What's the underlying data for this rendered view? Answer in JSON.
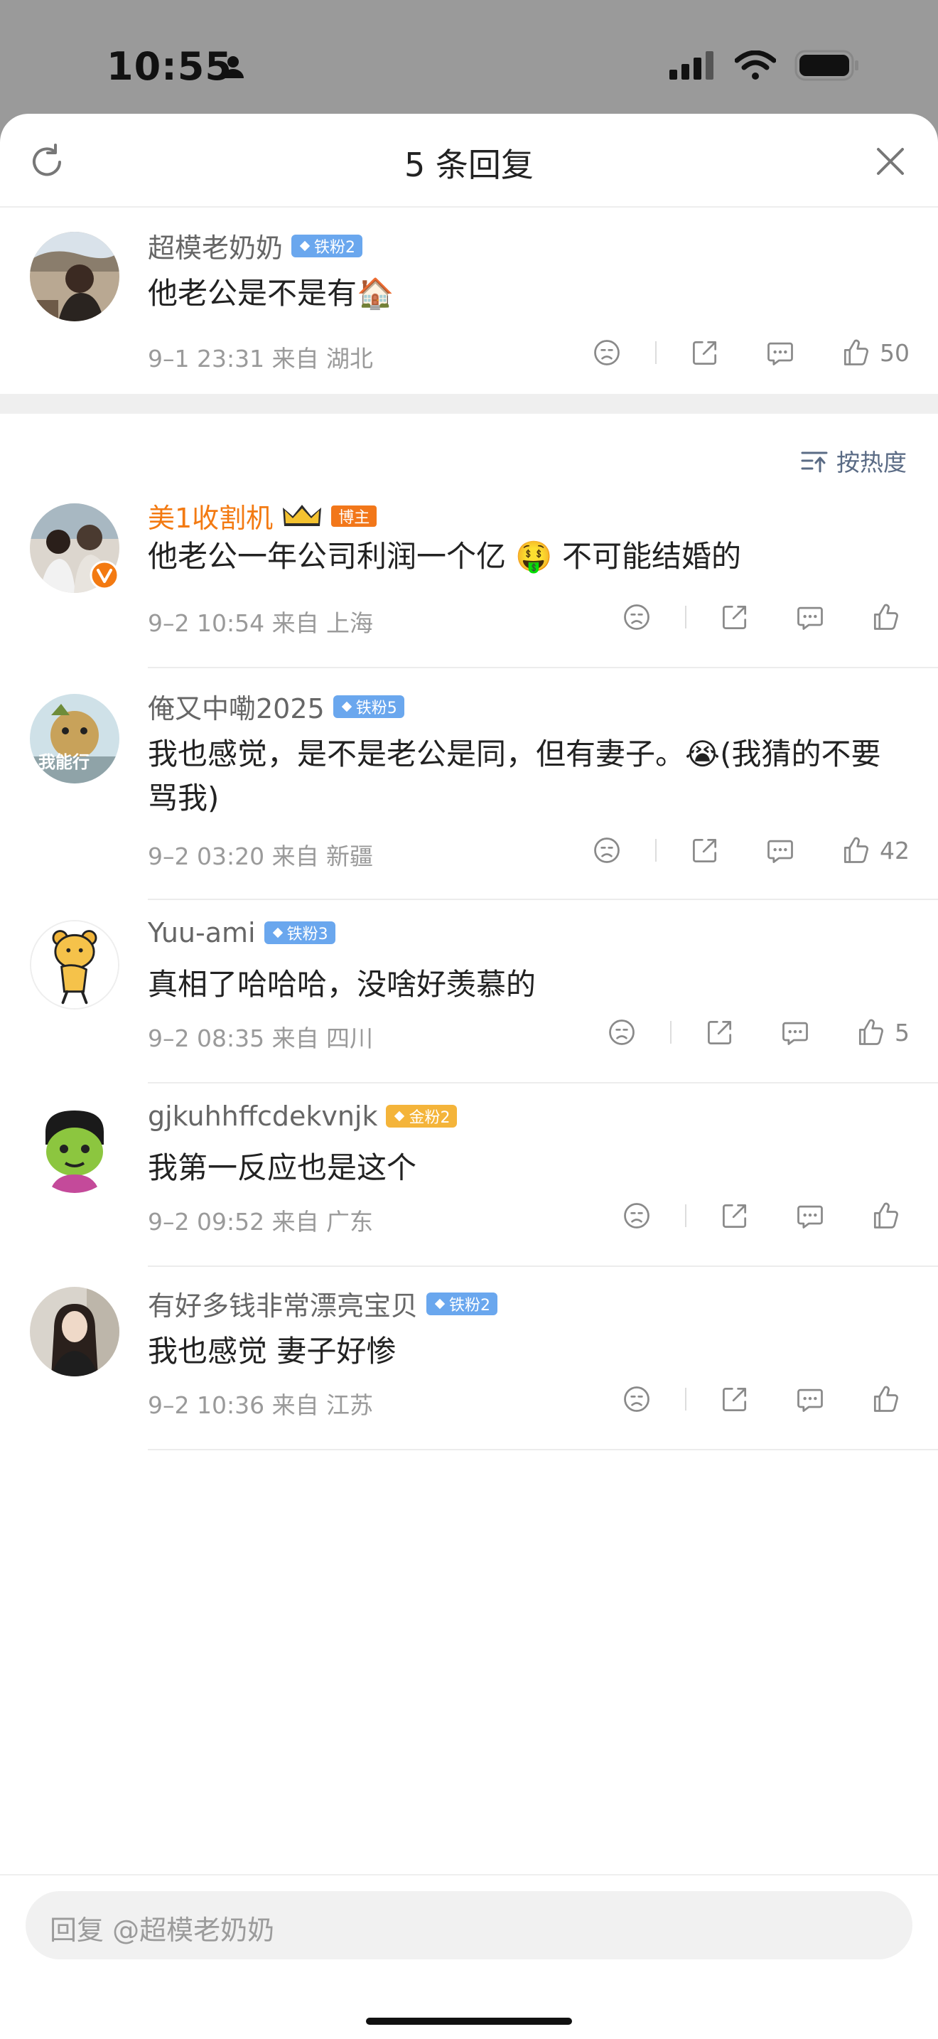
{
  "status_bar": {
    "time": "10:55"
  },
  "header": {
    "title": "5 条回复"
  },
  "root": {
    "name": "超模老奶奶",
    "badge": "铁粉2",
    "text": "他老公是不是有🏠",
    "meta": "9–1 23:31  来自 湖北",
    "likes": "50"
  },
  "sort": {
    "label": "按热度"
  },
  "replies": [
    {
      "name": "美1收割机",
      "badge": "博主",
      "text": "他老公一年公司利润一个亿 🤑 不可能结婚的",
      "meta": "9–2 10:54  来自 上海",
      "likes": ""
    },
    {
      "name": "俺又中嘞2025",
      "badge": "铁粉5",
      "text": "我也感觉，是不是老公是同，但有妻子。😭(我猜的不要骂我)",
      "meta": "9–2 03:20  来自 新疆",
      "likes": "42"
    },
    {
      "name": "Yuu-ami",
      "badge": "铁粉3",
      "text": "真相了哈哈哈，没啥好羡慕的",
      "meta": "9–2 08:35  来自 四川",
      "likes": "5"
    },
    {
      "name": "gjkuhhffcdekvnjk",
      "badge": "金粉2",
      "text": "我第一反应也是这个",
      "meta": "9–2 09:52  来自 广东",
      "likes": ""
    },
    {
      "name": "有好多钱非常漂亮宝贝",
      "badge": "铁粉2",
      "text": "我也感觉 妻子好惨",
      "meta": "9–2 10:36  来自 江苏",
      "likes": ""
    }
  ],
  "reply_input": {
    "placeholder": "回复 @超模老奶奶"
  },
  "colors": {
    "accent_orange": "#f37a12",
    "fan_badge": "#6aa7ee",
    "gold_badge": "#f4b43a"
  }
}
